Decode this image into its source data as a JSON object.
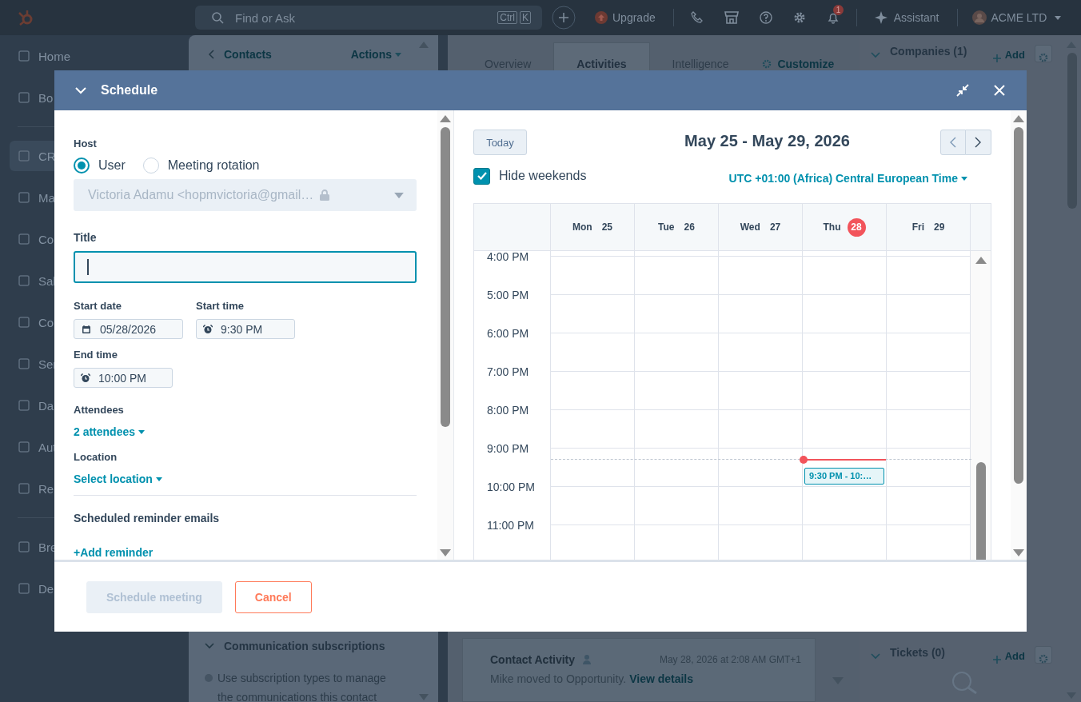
{
  "top_bar": {
    "search": {
      "placeholder": "Find or Ask",
      "keys": [
        "Ctrl",
        "K"
      ]
    },
    "upgrade": "Upgrade",
    "notifications": "1",
    "assistant": "Assistant",
    "account": "ACME LTD"
  },
  "sidebar": {
    "items": [
      {
        "label": "Home",
        "selected": false
      },
      {
        "label": "Bo",
        "selected": false
      },
      {
        "label": "CR",
        "selected": true
      },
      {
        "label": "Ma",
        "selected": false
      },
      {
        "label": "Co",
        "selected": false
      },
      {
        "label": "Sal",
        "selected": false
      },
      {
        "label": "Co",
        "selected": false
      },
      {
        "label": "Ser",
        "selected": false
      },
      {
        "label": "Da",
        "selected": false
      },
      {
        "label": "Aut",
        "selected": false
      },
      {
        "label": "Re",
        "selected": false
      },
      {
        "label": "Bre",
        "selected": false
      },
      {
        "label": "De",
        "selected": false
      }
    ]
  },
  "contact_panel": {
    "back": "Contacts",
    "actions": "Actions",
    "section": "Communication subscriptions",
    "note": "Use subscription types to manage the communications this contact"
  },
  "record_tabs": [
    {
      "label": "Overview",
      "selected": false
    },
    {
      "label": "Activities",
      "selected": true
    },
    {
      "label": "Intelligence",
      "selected": false
    }
  ],
  "customize": "Customize",
  "activity_card": {
    "title": "Contact Activity",
    "timestamp": "May 28, 2026 at 2:08 AM GMT+1",
    "text": "Mike moved to Opportunity.",
    "link": "View details"
  },
  "right_panel": {
    "sections": [
      {
        "title": "Companies (1)",
        "add": "Add"
      },
      {
        "title": "Tickets (0)",
        "add": "Add"
      }
    ]
  },
  "modal": {
    "title": "Schedule",
    "form": {
      "host_label": "Host",
      "host_options": [
        {
          "label": "User",
          "selected": true
        },
        {
          "label": "Meeting rotation",
          "selected": false
        }
      ],
      "host_value": "Victoria Adamu <hopmvictoria@gmail…",
      "title_label": "Title",
      "start_date_label": "Start date",
      "start_date": "05/28/2026",
      "start_time_label": "Start time",
      "start_time": "9:30 PM",
      "end_time_label": "End time",
      "end_time": "10:00 PM",
      "attendees_label": "Attendees",
      "attendees": "2 attendees",
      "location_label": "Location",
      "location": "Select location",
      "reminders_label": "Scheduled reminder emails",
      "add_reminder": "+Add reminder"
    },
    "calendar": {
      "today": "Today",
      "range": "May 25 - May 29, 2026",
      "hide_weekends": {
        "label": "Hide weekends",
        "checked": true
      },
      "timezone": "UTC +01:00 (Africa) Central European Time",
      "days": [
        {
          "name": "Mon",
          "date": "25",
          "today": false
        },
        {
          "name": "Tue",
          "date": "26",
          "today": false
        },
        {
          "name": "Wed",
          "date": "27",
          "today": false
        },
        {
          "name": "Thu",
          "date": "28",
          "today": true,
          "events": [
            {
              "label": "9:30 PM - 10:…"
            }
          ]
        },
        {
          "name": "Fri",
          "date": "29",
          "today": false
        }
      ],
      "hours": [
        "4:00 PM",
        "5:00 PM",
        "6:00 PM",
        "7:00 PM",
        "8:00 PM",
        "9:00 PM",
        "10:00 PM",
        "11:00 PM"
      ]
    },
    "buttons": [
      {
        "label": "Schedule meeting",
        "kind": "primary",
        "disabled": true
      },
      {
        "label": "Cancel",
        "kind": "secondary",
        "disabled": false
      }
    ]
  }
}
